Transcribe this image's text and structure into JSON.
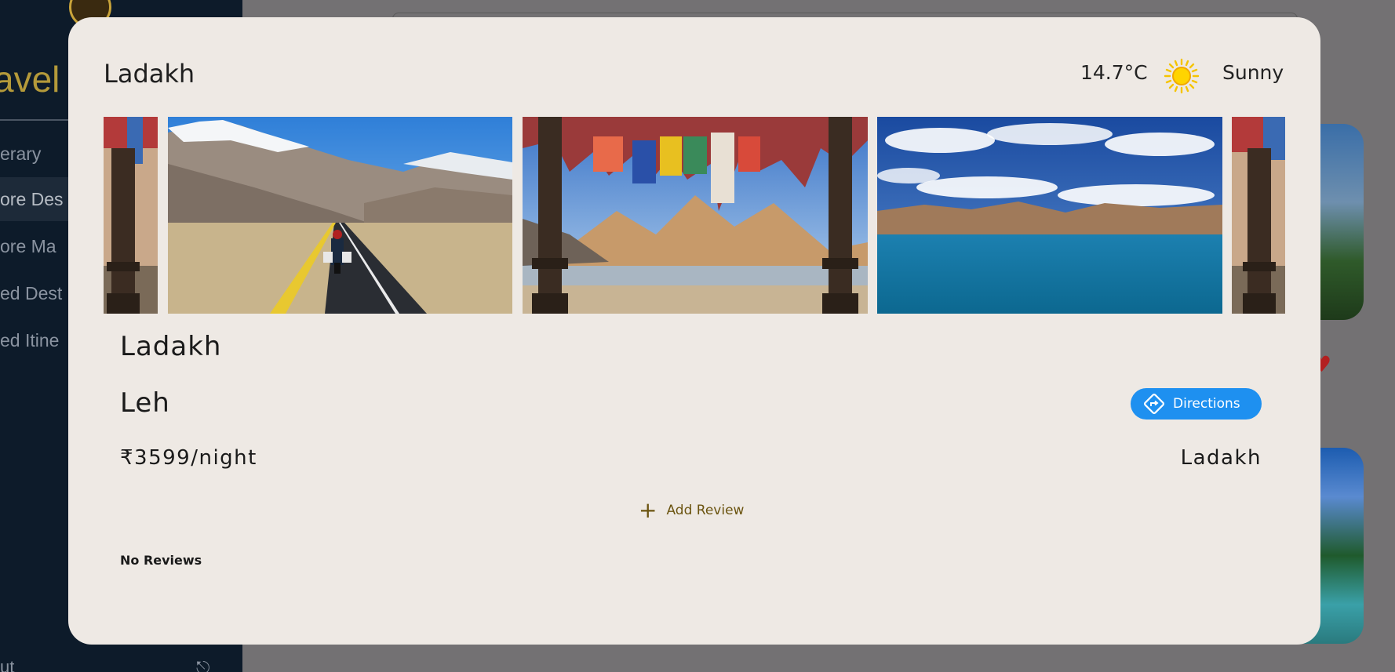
{
  "background": {
    "brand_text": "avel",
    "sidebar_items": [
      {
        "label": "erary",
        "active": false
      },
      {
        "label": "ore Des",
        "active": true
      },
      {
        "label": "ore Ma",
        "active": false
      },
      {
        "label": "ed Dest",
        "active": false
      },
      {
        "label": "ed Itine",
        "active": false
      }
    ],
    "bottom_label": "ut"
  },
  "modal": {
    "title": "Ladakh",
    "weather": {
      "temperature": "14.7°C",
      "condition": "Sunny",
      "icon": "sun-icon"
    },
    "photos": [
      {
        "name": "prayer-flags-pillar-partial"
      },
      {
        "name": "biker-mountain-road"
      },
      {
        "name": "prayer-flags-mountain-lake"
      },
      {
        "name": "pangong-lake-blue-sky"
      },
      {
        "name": "prayer-flags-pillar-partial"
      }
    ],
    "place_name": "Ladakh",
    "city": "Leh",
    "directions_label": "Directions",
    "price": "₹3599/night",
    "region": "Ladakh",
    "add_review_label": "Add Review",
    "reviews_status": "No Reviews"
  },
  "colors": {
    "accent": "#1e90f0",
    "review_link": "#6b5410",
    "modal_bg": "#eee9e4",
    "sidebar_bg": "#0d1b2a"
  }
}
